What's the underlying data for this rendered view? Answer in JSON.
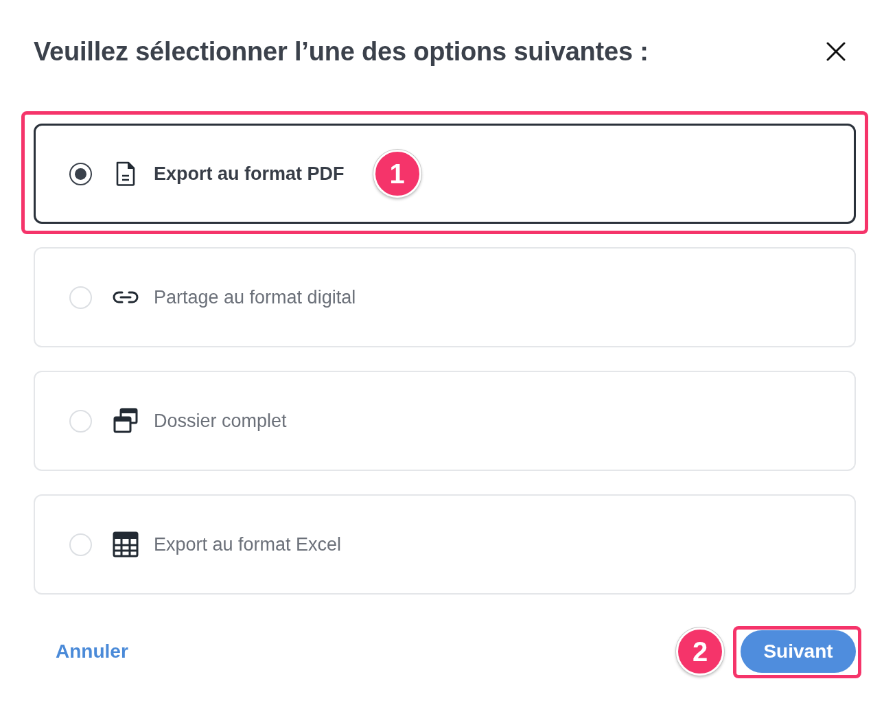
{
  "dialog": {
    "title": "Veuillez sélectionner l’une des options suivantes :"
  },
  "options": [
    {
      "kind": "pdf",
      "label": "Export au format PDF",
      "selected": true,
      "callout": "1"
    },
    {
      "kind": "link",
      "label": "Partage au format digital",
      "selected": false
    },
    {
      "kind": "folders",
      "label": "Dossier complet",
      "selected": false
    },
    {
      "kind": "table",
      "label": "Export au format Excel",
      "selected": false
    }
  ],
  "footer": {
    "cancel": "Annuler",
    "next": {
      "label": "Suivant",
      "callout": "2"
    }
  }
}
